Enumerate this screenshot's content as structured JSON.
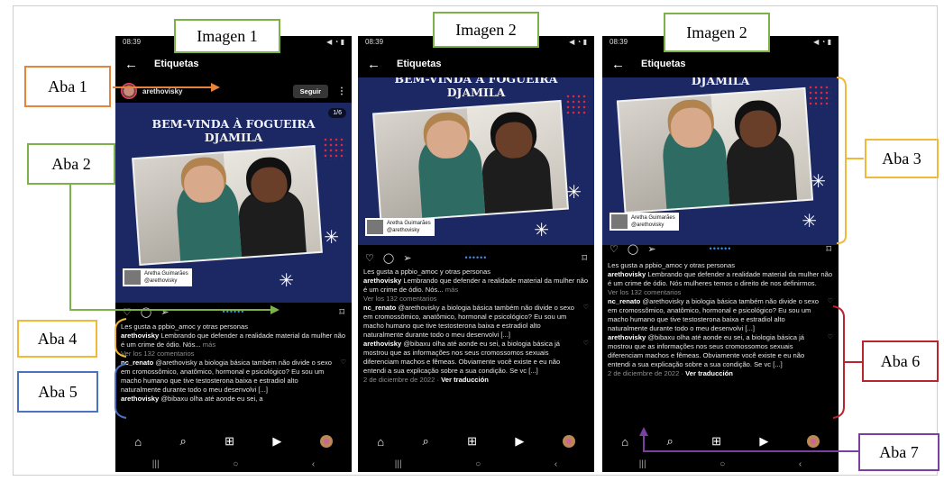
{
  "labels": {
    "imagen1": "Imagen 1",
    "imagen2a": "Imagen 2",
    "imagen2b": "Imagen 2",
    "aba1": "Aba 1",
    "aba2": "Aba 2",
    "aba3": "Aba 3",
    "aba4": "Aba 4",
    "aba5": "Aba 5",
    "aba6": "Aba 6",
    "aba7": "Aba 7"
  },
  "phone": {
    "time": "08:39",
    "status_icons": "◀ ◔ ▮",
    "title": "Etiquetas",
    "username": "arethovisky",
    "follow_label": "Seguir",
    "counter": "1/6",
    "headline_1": "BEM-VINDA À FOGUEIRA",
    "headline_2": "DJAMILA",
    "headline_top_clipped": "BEM-VINDA À FOGUEIRA",
    "credit_name": "Aretha Guimarães",
    "credit_handle": "@arethovisky",
    "likes": "Les gusta a ppbio_amoc y otras personas",
    "caption_user": "arethovisky",
    "caption_text": "Lembrando que defender a realidade material da mulher não é um crime de ódio. Nós...",
    "caption_more": "más",
    "caption_text_full": "Lembrando que defender a realidade material da mulher não é um crime de ódio. Nós mulheres temos o direito de nos definirmos.",
    "view_comments": "Ver los 132 comentarios",
    "c1_user": "nc_renato",
    "c1_text": "@arethovisky a biologia básica também não divide o sexo em cromossômico, anatômico, hormonal e psicológico? Eu sou um macho humano que tive testosterona baixa e estradiol alto naturalmente durante todo o meu desenvolvi [...]",
    "c2_user": "arethovisky",
    "c2_text": "@bibaxu olha até aonde eu sei, a biologia básica já mostrou que as informações nos seus cromossomos sexuais diferenciam machos e fêmeas. Obviamente você existe e eu não entendi a sua explicação sobre a sua condição. Se vc [...]",
    "c2_text_partial": "@bibaxu olha até aonde eu sei, a",
    "date": "2 de diciembre de 2022",
    "translate": "Ver traducción",
    "nav_icons": [
      "⌂",
      "⌕",
      "⊞",
      "▶",
      ""
    ],
    "sys_icons": [
      "|||",
      "○",
      "‹"
    ]
  },
  "colors": {
    "green": "#7db24a",
    "orange": "#e8833a",
    "yellow": "#f0b93a",
    "blue": "#4a73c4",
    "red": "#b8252d",
    "purple": "#7b3fa0"
  }
}
